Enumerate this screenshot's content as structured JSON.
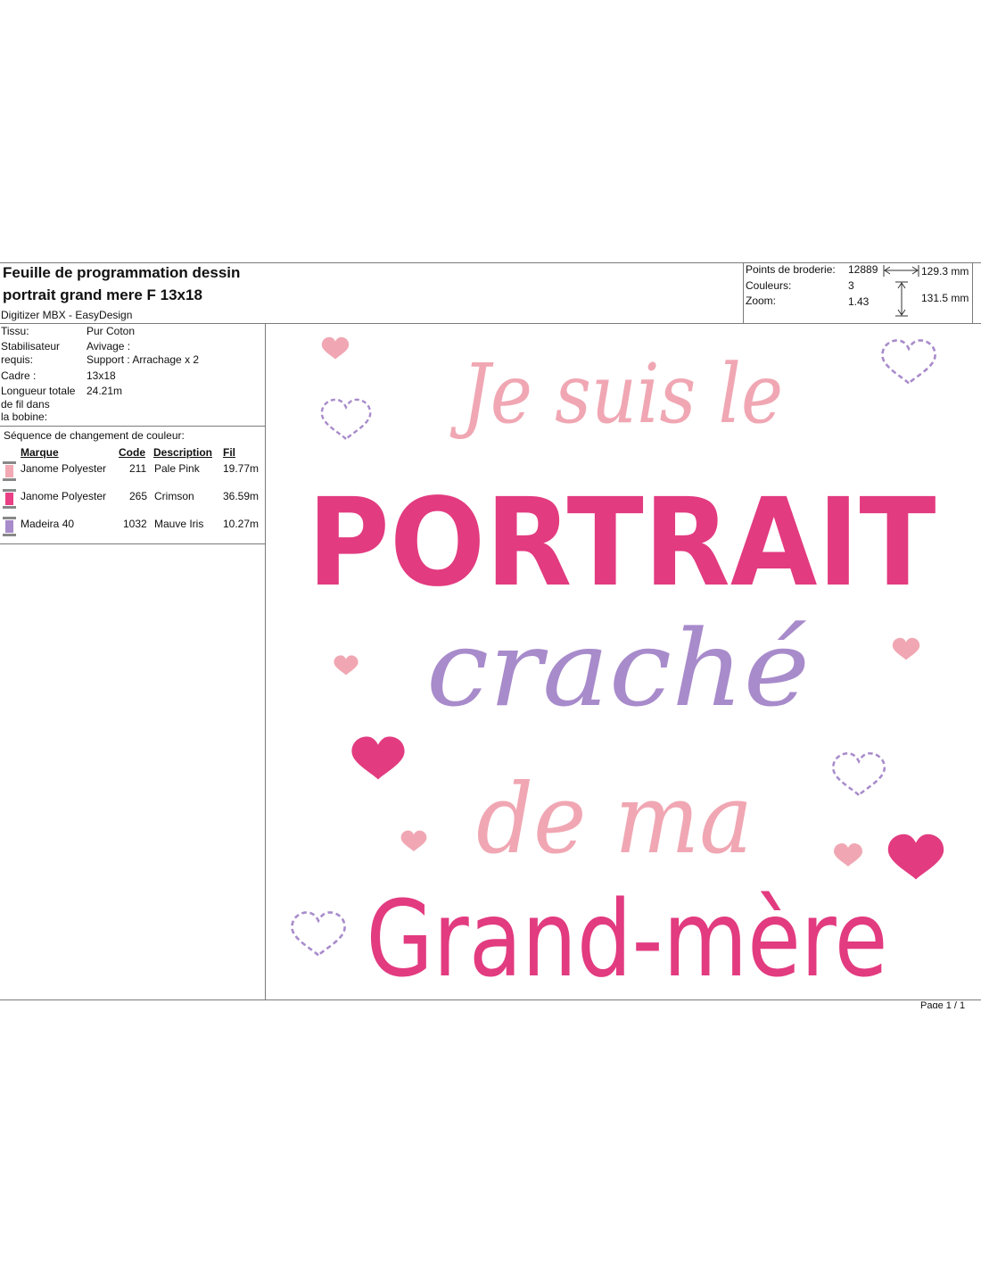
{
  "header": {
    "title_line1": "Feuille de programmation dessin",
    "title_line2": "portrait grand mere F 13x18",
    "software": "Digitizer MBX - EasyDesign"
  },
  "stats": {
    "stitches_label": "Points de broderie:",
    "stitches_value": "12889",
    "colors_label": "Couleurs:",
    "colors_value": "3",
    "zoom_label": "Zoom:",
    "zoom_value": "1.43",
    "width_value": "129.3 mm",
    "height_value": "131.5 mm"
  },
  "specs": {
    "fabric_label": "Tissu:",
    "fabric_value": "Pur Coton",
    "stabilizer_label_1": "Stabilisateur",
    "stabilizer_label_2": "requis:",
    "stabilizer_value_1": "Avivage :",
    "stabilizer_value_2": "Support : Arrachage x 2",
    "frame_label": "Cadre :",
    "frame_value": "13x18",
    "length_label_1": "Longueur totale",
    "length_label_2": "de fil dans",
    "length_label_3": "la bobine:",
    "length_value": "24.21m"
  },
  "sequence": {
    "title": "Séquence de changement de couleur:",
    "col_brand": "Marque",
    "col_code": "Code",
    "col_desc": "Description",
    "col_thread": "Fil",
    "rows": [
      {
        "brand": "Janome Polyester",
        "code": "211",
        "desc": "Pale Pink",
        "thread": "19.77m",
        "color": "#f2a9b4"
      },
      {
        "brand": "Janome Polyester",
        "code": "265",
        "desc": "Crimson",
        "thread": "36.59m",
        "color": "#e83f85"
      },
      {
        "brand": "Madeira 40",
        "code": "1032",
        "desc": "Mauve Iris",
        "thread": "10.27m",
        "color": "#a88bcb"
      }
    ]
  },
  "design": {
    "line1": "Je suis le",
    "line2": "PORTRAIT",
    "line3": "craché",
    "line4": "de ma",
    "line5": "Grand-mère",
    "colors": {
      "pale_pink": "#f0a7b3",
      "crimson": "#e23b80",
      "mauve": "#a88bcb"
    }
  },
  "footer": {
    "page": "Page 1 / 1"
  }
}
